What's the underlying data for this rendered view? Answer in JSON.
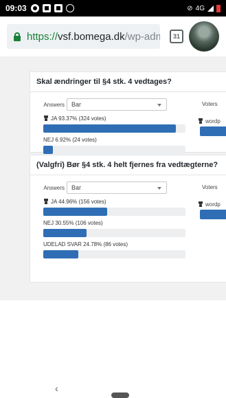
{
  "status_bar": {
    "time": "09:03",
    "network": "4G",
    "icons": [
      "camera-app-icon",
      "square-app-icon",
      "square-app-icon",
      "messenger-icon",
      "mute-icon",
      "signal-icon",
      "battery-icon"
    ]
  },
  "browser": {
    "url_protocol": "https://",
    "url_host": "vsf.bomega.dk",
    "url_path": "/wp-admir",
    "tab_count": "31"
  },
  "polls": [
    {
      "question": "Skal ændringer til §4 stk. 4 vedtages?",
      "answers_label": "Answers",
      "select_value": "Bar",
      "voters_label": "Voters",
      "voter_item": "wordp",
      "answers": [
        {
          "label": "JA 93.37% (324 votes)",
          "percent": 93.37,
          "winner": true
        },
        {
          "label": "NEJ 6.92% (24 votes)",
          "percent": 6.92,
          "winner": false
        }
      ]
    },
    {
      "question": "(Valgfri) Bør §4 stk. 4 helt fjernes fra vedtægterne?",
      "answers_label": "Answers",
      "select_value": "Bar",
      "voters_label": "Voters",
      "voter_item": "wordp",
      "answers": [
        {
          "label": "JA 44.96% (156 votes)",
          "percent": 44.96,
          "winner": true
        },
        {
          "label": "NEJ 30.55% (106 votes)",
          "percent": 30.55,
          "winner": false
        },
        {
          "label": "UDELAD SVAR 24.78% (86 votes)",
          "percent": 24.78,
          "winner": false
        }
      ]
    }
  ],
  "colors": {
    "bar": "#2f6eb5",
    "track": "#eceef0",
    "secure": "#188038"
  },
  "nav": {
    "back_glyph": "‹"
  }
}
